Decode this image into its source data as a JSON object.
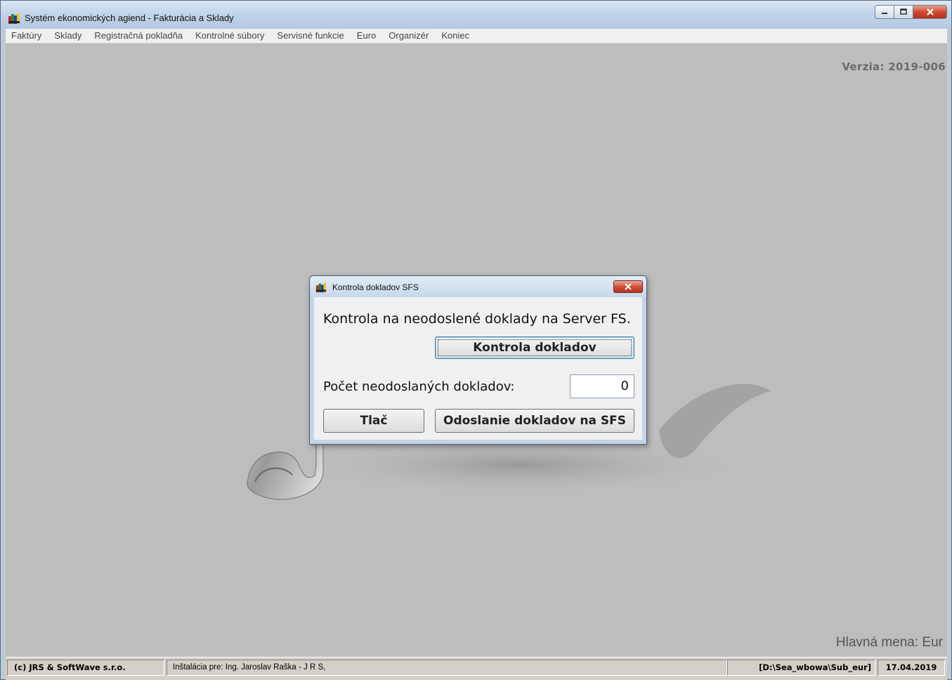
{
  "window": {
    "title": "Systém ekonomických agiend - Fakturácia a Sklady",
    "app_icon": "app-logo-icon",
    "buttons": [
      "minimize-icon",
      "maximize-icon",
      "close-icon"
    ]
  },
  "menu": {
    "items": [
      "Faktúry",
      "Sklady",
      "Registračná pokladňa",
      "Kontrolné súbory",
      "Servisné funkcie",
      "Euro",
      "Organizér",
      "Koniec"
    ]
  },
  "desk": {
    "version": "Verzia: 2019-006",
    "currency": "Hlavná mena: Eur"
  },
  "dialog": {
    "title": "Kontrola dokladov SFS",
    "heading": "Kontrola na neodoslené doklady na Server FS.",
    "check_button": "Kontrola dokladov",
    "count_label": "Počet neodoslaných dokladov:",
    "count_value": "0",
    "print_button": "Tlač",
    "send_button": "Odoslanie dokladov na SFS"
  },
  "statusbar": {
    "copyright": "(c) JRS & SoftWave s.r.o.",
    "installation": "Inštalácia pre:  Ing. Jaroslav Raška - J R S,",
    "path": "[D:\\Sea_wbowa\\Sub_eur]",
    "date": "17.04.2019"
  },
  "colors": {
    "desktop": "#bdbdbd",
    "titlebar": "#c2d5ea",
    "close_red": "#c9452f",
    "dialog_face": "#f0f0f0"
  }
}
